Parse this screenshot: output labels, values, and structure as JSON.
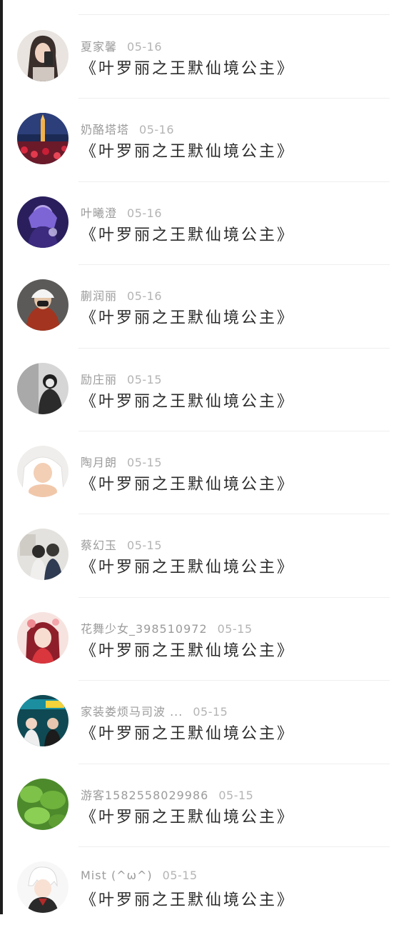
{
  "comments": [
    {
      "user": "夏家馨",
      "date": "05-16",
      "text": "《叶罗丽之王默仙境公主》",
      "avatar_icon": "girl-phone-selfie-avatar"
    },
    {
      "user": "奶酪塔塔",
      "date": "05-16",
      "text": "《叶罗丽之王默仙境公主》",
      "avatar_icon": "night-tower-flowers-avatar"
    },
    {
      "user": "叶曦澄",
      "date": "05-16",
      "text": "《叶罗丽之王默仙境公主》",
      "avatar_icon": "purple-anime-character-avatar"
    },
    {
      "user": "蒯润丽",
      "date": "05-16",
      "text": "《叶罗丽之王默仙境公主》",
      "avatar_icon": "person-red-hoodie-cap-avatar"
    },
    {
      "user": "励庄丽",
      "date": "05-15",
      "text": "《叶罗丽之王默仙境公主》",
      "avatar_icon": "monochrome-girl-avatar"
    },
    {
      "user": "陶月朗",
      "date": "05-15",
      "text": "《叶罗丽之王默仙境公主》",
      "avatar_icon": "baby-towel-avatar"
    },
    {
      "user": "蔡幻玉",
      "date": "05-15",
      "text": "《叶罗丽之王默仙境公主》",
      "avatar_icon": "couple-photo-avatar"
    },
    {
      "user": "花舞少女_398510972",
      "date": "05-15",
      "text": "《叶罗丽之王默仙境公主》",
      "avatar_icon": "anime-girl-avatar"
    },
    {
      "user": "家装娄烦马司波 ...",
      "date": "05-15",
      "text": "《叶罗丽之王默仙境公主》",
      "avatar_icon": "home-decor-promo-avatar"
    },
    {
      "user": "游客1582558029986",
      "date": "05-15",
      "text": "《叶罗丽之王默仙境公主》",
      "avatar_icon": "green-leaves-avatar"
    },
    {
      "user": "Mist (^ω^)",
      "date": "05-15",
      "text": "《叶罗丽之王默仙境公主》",
      "avatar_icon": "white-hair-anime-boy-avatar"
    }
  ]
}
